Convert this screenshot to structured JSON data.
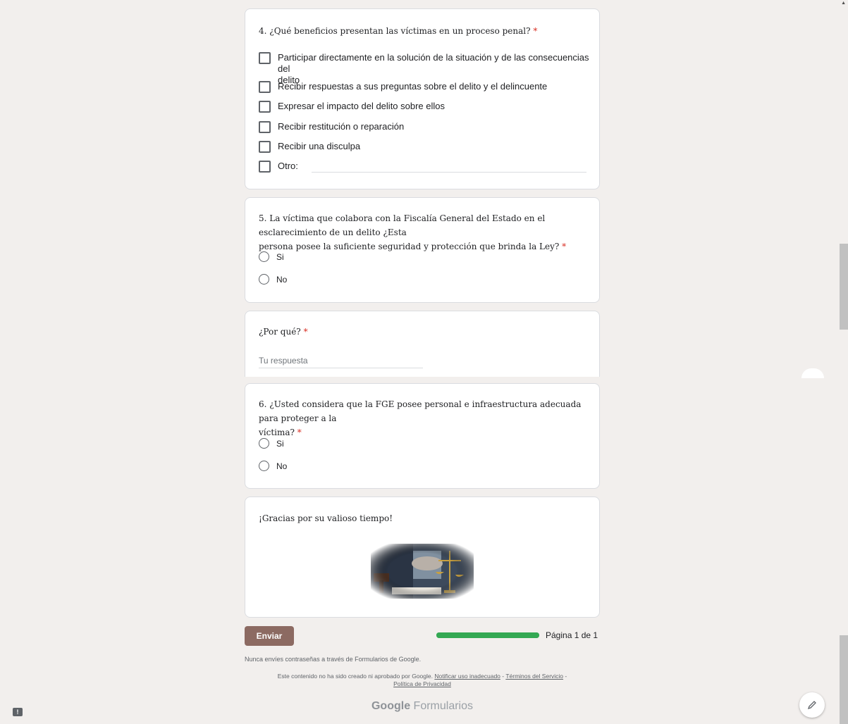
{
  "q4": {
    "number_title": "4. ¿Qué beneficios presentan las víctimas en un proceso penal?",
    "required": "*",
    "options": [
      "Participar directamente en la solución de la situación y de las consecuencias del",
      "delito",
      "Recibir respuestas a sus preguntas sobre el delito y el delincuente",
      "Expresar el impacto del delito sobre ellos",
      "Recibir restitución o reparación",
      "Recibir una disculpa",
      "Otro:"
    ]
  },
  "q5": {
    "line1": "5. La víctima que colabora con la Fiscalía General del Estado en el esclarecimiento de un delito ¿Esta",
    "line2": "persona posee la suficiente seguridad y protección que brinda la Ley?",
    "required": "*",
    "options": [
      "Si",
      "No"
    ]
  },
  "why": {
    "title": "¿Por qué?",
    "required": "*",
    "placeholder": "Tu respuesta"
  },
  "q6": {
    "line1": "6. ¿Usted considera que la FGE posee personal e infraestructura adecuada para proteger a la",
    "line2": "víctima?",
    "required": "*",
    "options": [
      "Si",
      "No"
    ]
  },
  "thanks": {
    "text": "¡Gracias por su valioso tiempo!"
  },
  "actions": {
    "submit_label": "Enviar",
    "page_label": "Página 1 de 1",
    "progress": 1.0
  },
  "notice": "Nunca envíes contraseñas a través de Formularios de Google.",
  "footer": {
    "prefix": "Este contenido no ha sido creado ni aprobado por Google.",
    "report": "Notificar uso inadecuado",
    "sep1": " - ",
    "terms": "Términos del Servicio",
    "sep2": " -",
    "privacy": "Política de Privacidad"
  },
  "brand": {
    "google": "Google",
    "product": "Formularios"
  },
  "icons": {
    "edit": "pencil-icon",
    "feedback": "feedback-icon"
  },
  "colors": {
    "accent": "#8c6a62",
    "progress": "#34a853",
    "required": "#d93025"
  }
}
